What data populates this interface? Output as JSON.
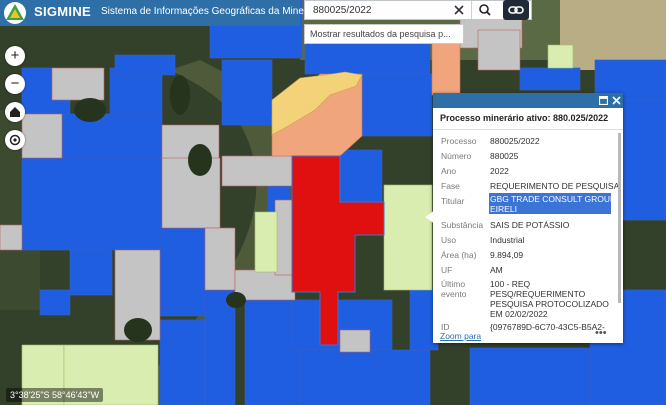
{
  "app": {
    "brand": "SIGMINE",
    "subtitle": "Sistema de Informações Geográficas da Mineração"
  },
  "search": {
    "value": "880025/2022",
    "suggestion": "Mostrar resultados da pesquisa p..."
  },
  "controls": {
    "zoom_in": "+",
    "zoom_out": "−"
  },
  "popup": {
    "title": "Processo minerário ativo: 880.025/2022",
    "fields": [
      {
        "label": "Processo",
        "value": "880025/2022"
      },
      {
        "label": "Número",
        "value": "880025"
      },
      {
        "label": "Ano",
        "value": "2022"
      },
      {
        "label": "Fase",
        "value": "REQUERIMENTO DE PESQUISA"
      },
      {
        "label": "Titular",
        "value_line1": "GBG TRADE CONSULT GROUP",
        "value_line2": "EIRELI"
      },
      {
        "label": "Substância",
        "value": "SAIS DE POTÁSSIO"
      },
      {
        "label": "Uso",
        "value": "Industrial"
      },
      {
        "label": "Área (ha)",
        "value": "9.894,09"
      },
      {
        "label": "UF",
        "value": "AM"
      },
      {
        "label_line1": "Último",
        "label_line2": "evento",
        "value_line1": "100 - REQ",
        "value_line2": "PESQ/REQUERIMENTO",
        "value_line3": "PESQUISA PROTOCOLIZADO",
        "value_line4": "EM 02/02/2022"
      },
      {
        "label": "ID",
        "value": "{0976789D-6C70-43C5-B5A2-"
      }
    ],
    "zoom_link": "Zoom para",
    "more": "•••"
  },
  "coords": "3°38'25\"S 58°46'43\"W",
  "colors": {
    "header": "#2f6fa7",
    "blue_polygon": "#1f5ee0",
    "gray_polygon": "#c4c4c4",
    "red_polygon": "#e01010",
    "pale_green_polygon": "#d9edb0",
    "salmon_polygon": "#f1a57c",
    "selection": "#3b73d6"
  }
}
